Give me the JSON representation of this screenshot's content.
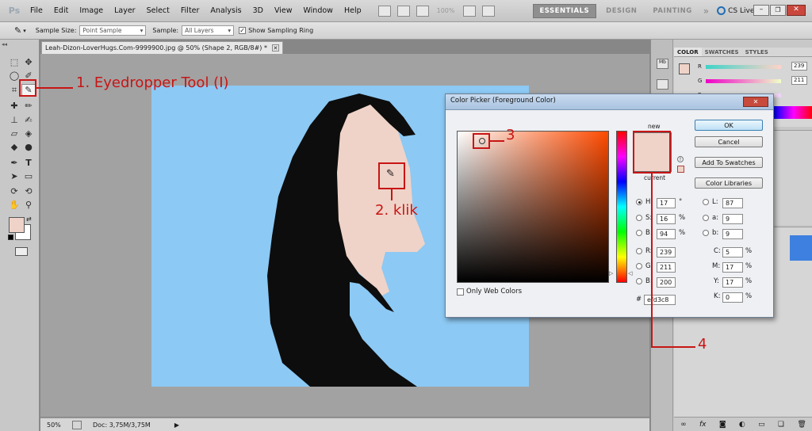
{
  "app": {
    "logo": "Ps",
    "menus": [
      "File",
      "Edit",
      "Image",
      "Layer",
      "Select",
      "Filter",
      "Analysis",
      "3D",
      "View",
      "Window",
      "Help"
    ],
    "zoom_display": "100%",
    "workspaces": [
      "ESSENTIALS",
      "DESIGN",
      "PAINTING"
    ],
    "active_workspace": "ESSENTIALS",
    "cs_live": "CS Live"
  },
  "options_bar": {
    "sample_size_label": "Sample Size:",
    "sample_size_value": "Point Sample",
    "sample_label": "Sample:",
    "sample_value": "All Layers",
    "show_ring_label": "Show Sampling Ring",
    "show_ring_checked": true
  },
  "document": {
    "tab_title": "Leah-Dizon-LoverHugs.Com-9999900.jpg @ 50% (Shape 2, RGB/8#) *",
    "zoom": "50%",
    "doc_info": "Doc: 3,75M/3,75M",
    "canvas_bg": "#8cc9f4",
    "skin_color": "#efd3c8",
    "hair_color": "#0d0d0d"
  },
  "panels": {
    "tabs": [
      "COLOR",
      "SWATCHES",
      "STYLES"
    ],
    "active_tab": "COLOR",
    "r_label": "R",
    "g_label": "G",
    "b_label": "B",
    "r_value": "239",
    "g_value": "211",
    "b_value": "",
    "second_tab_marks": [
      "«"
    ]
  },
  "color_picker": {
    "title": "Color Picker (Foreground Color)",
    "ok": "OK",
    "cancel": "Cancel",
    "add_to_swatches": "Add To Swatches",
    "color_libraries": "Color Libraries",
    "new_label": "new",
    "current_label": "current",
    "only_web_colors": "Only Web Colors",
    "new_color": "#efd3c8",
    "current_color": "#efd3c8",
    "hue_color": "#ff4a00",
    "fields": {
      "H": {
        "label": "H:",
        "value": "17",
        "unit": "°",
        "selected": true
      },
      "S": {
        "label": "S:",
        "value": "16",
        "unit": "%"
      },
      "B": {
        "label": "B:",
        "value": "94",
        "unit": "%"
      },
      "R": {
        "label": "R:",
        "value": "239"
      },
      "G": {
        "label": "G:",
        "value": "211"
      },
      "Bl": {
        "label": "B:",
        "value": "200"
      },
      "L": {
        "label": "L:",
        "value": "87"
      },
      "a": {
        "label": "a:",
        "value": "9"
      },
      "b": {
        "label": "b:",
        "value": "9"
      },
      "C": {
        "label": "C:",
        "value": "5",
        "unit": "%"
      },
      "M": {
        "label": "M:",
        "value": "17",
        "unit": "%"
      },
      "Y": {
        "label": "Y:",
        "value": "17",
        "unit": "%"
      },
      "K": {
        "label": "K:",
        "value": "0",
        "unit": "%"
      }
    },
    "hex_label": "#",
    "hex_value": "efd3c8"
  },
  "annotations": {
    "step1": "1. Eyedropper Tool (I)",
    "step2": "2. klik",
    "step3": "3",
    "step4": "4",
    "color": "#c81515"
  }
}
